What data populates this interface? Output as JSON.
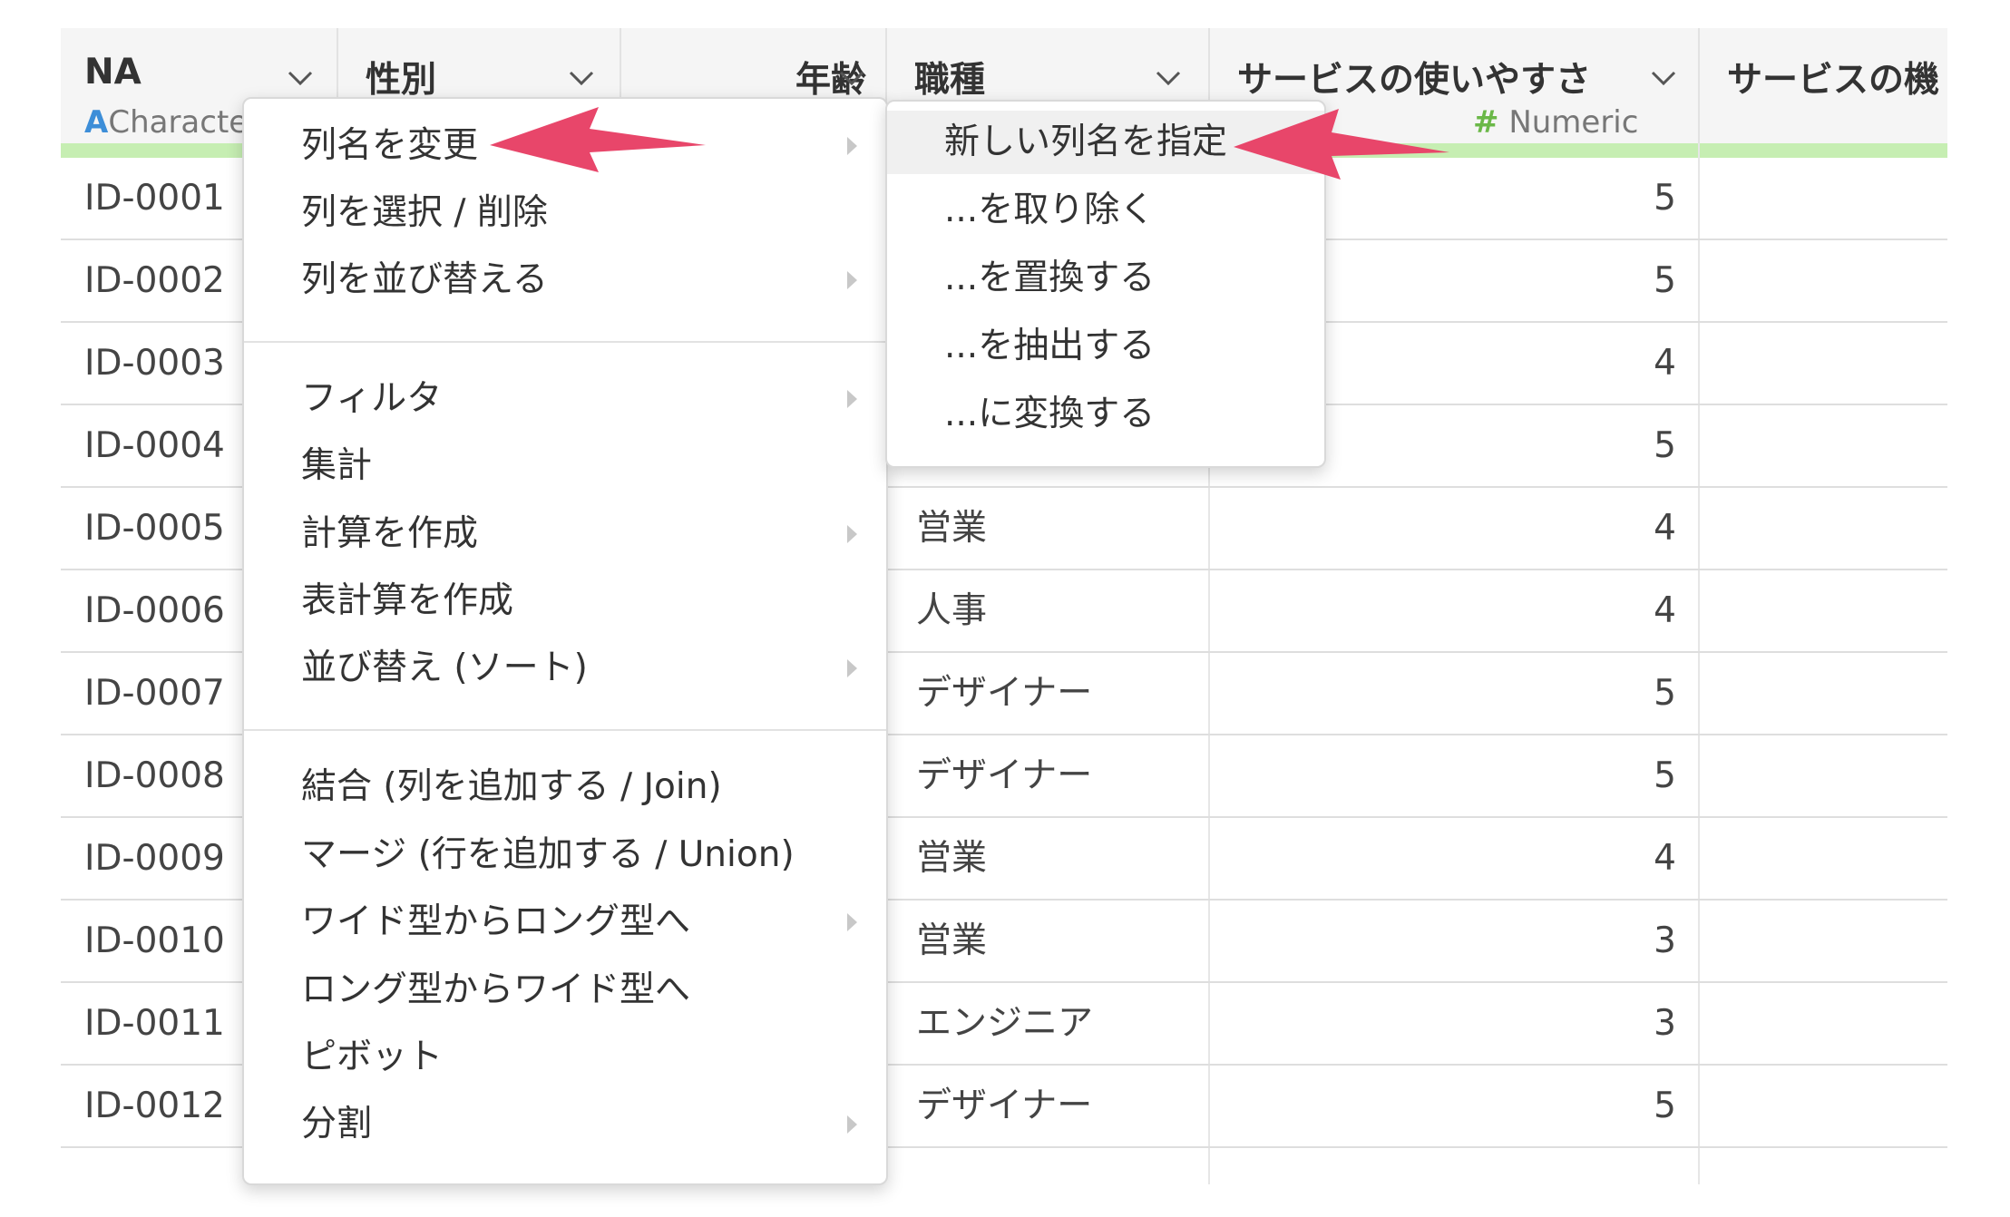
{
  "columns": [
    {
      "name": "NA",
      "type_glyph": "A",
      "type_label": "Character"
    },
    {
      "name": "性別"
    },
    {
      "name": "年齢"
    },
    {
      "name": "職種"
    },
    {
      "name": "サービスの使いやすさ",
      "type_glyph": "#",
      "type_label": "Numeric"
    },
    {
      "name": "サービスの機"
    }
  ],
  "colors": {
    "header_bg": "#f5f5f5",
    "type_bar": "#c6eeb2",
    "character_type": "#3d8ed8",
    "numeric_type": "#6bb848",
    "arrow": "#e8466a",
    "menu_highlight": "#f0f0f0"
  },
  "rows": [
    {
      "id": "ID-0001",
      "job": "",
      "usability": "5"
    },
    {
      "id": "ID-0002",
      "job": "",
      "usability": "5"
    },
    {
      "id": "ID-0003",
      "job": "",
      "usability": "4"
    },
    {
      "id": "ID-0004",
      "job": "",
      "usability": "5"
    },
    {
      "id": "ID-0005",
      "job": "営業",
      "usability": "4"
    },
    {
      "id": "ID-0006",
      "job": "人事",
      "usability": "4"
    },
    {
      "id": "ID-0007",
      "job": "デザイナー",
      "usability": "5"
    },
    {
      "id": "ID-0008",
      "job": "デザイナー",
      "usability": "5"
    },
    {
      "id": "ID-0009",
      "job": "営業",
      "usability": "4"
    },
    {
      "id": "ID-0010",
      "job": "営業",
      "usability": "3"
    },
    {
      "id": "ID-0011",
      "job": "エンジニア",
      "usability": "3"
    },
    {
      "id": "ID-0012",
      "job": "デザイナー",
      "usability": "5"
    }
  ],
  "main_menu": [
    {
      "label": "列名を変更",
      "has_submenu": true
    },
    {
      "label": "列を選択 / 削除",
      "has_submenu": false
    },
    {
      "label": "列を並び替える",
      "has_submenu": true
    },
    {
      "label": "フィルタ",
      "has_submenu": true
    },
    {
      "label": "集計",
      "has_submenu": false
    },
    {
      "label": "計算を作成",
      "has_submenu": true
    },
    {
      "label": "表計算を作成",
      "has_submenu": false
    },
    {
      "label": "並び替え (ソート)",
      "has_submenu": true
    },
    {
      "label": "結合 (列を追加する / Join)",
      "has_submenu": false
    },
    {
      "label": "マージ (行を追加する / Union)",
      "has_submenu": false
    },
    {
      "label": "ワイド型からロング型へ",
      "has_submenu": true
    },
    {
      "label": "ロング型からワイド型へ",
      "has_submenu": false
    },
    {
      "label": "ピボット",
      "has_submenu": false
    },
    {
      "label": "分割",
      "has_submenu": true
    }
  ],
  "sub_menu": [
    {
      "label": "新しい列名を指定"
    },
    {
      "label": "...を取り除く"
    },
    {
      "label": "...を置換する"
    },
    {
      "label": "...を抽出する"
    },
    {
      "label": "...に変換する"
    }
  ]
}
